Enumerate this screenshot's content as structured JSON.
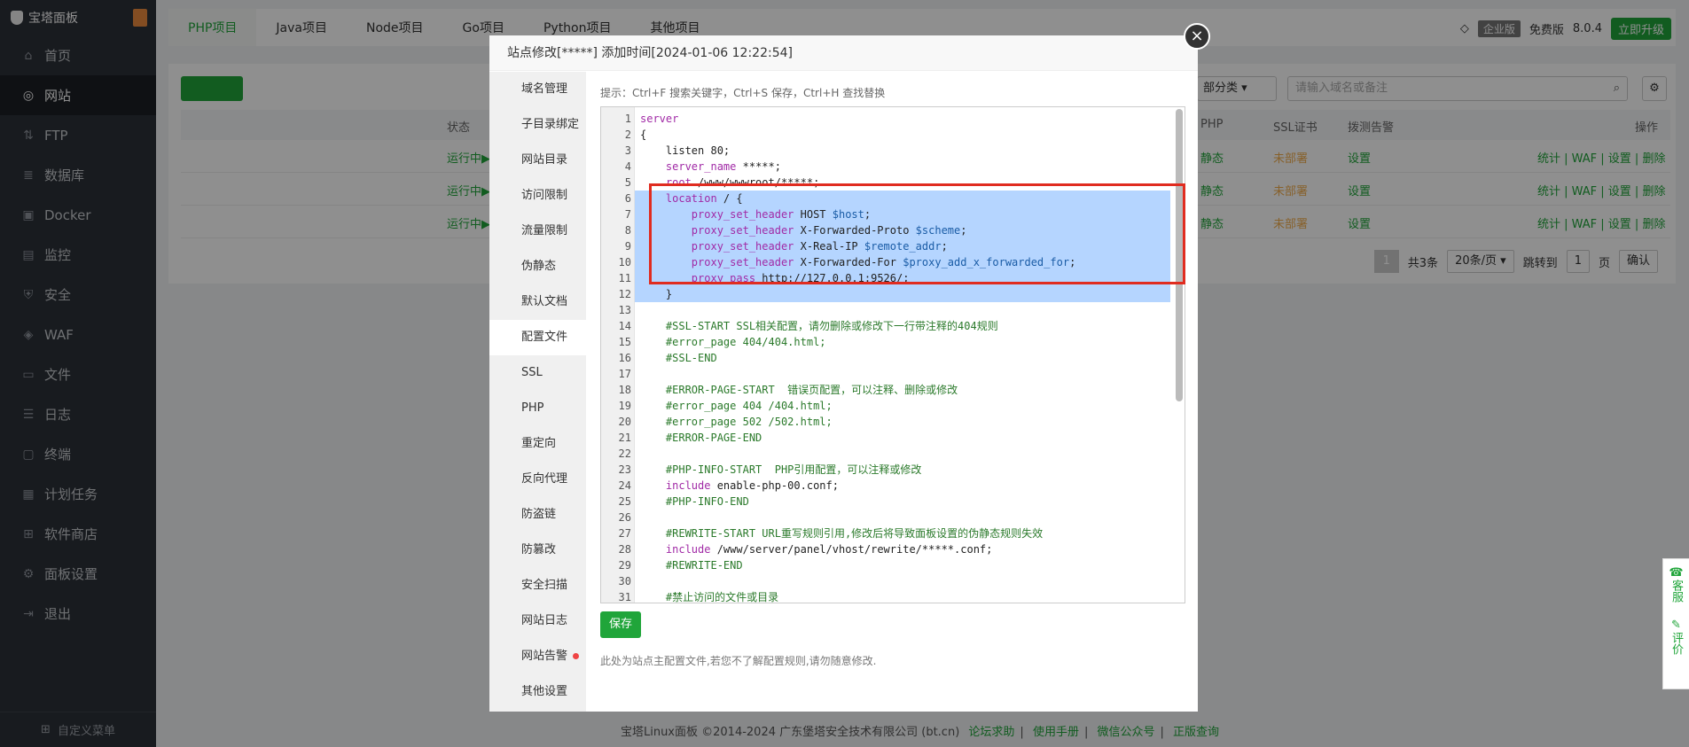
{
  "sidebar": {
    "brand": "宝塔面板",
    "items": [
      {
        "label": "首页",
        "icon": "home-icon"
      },
      {
        "label": "网站",
        "icon": "globe-icon",
        "active": true
      },
      {
        "label": "FTP",
        "icon": "ftp-icon"
      },
      {
        "label": "数据库",
        "icon": "database-icon"
      },
      {
        "label": "Docker",
        "icon": "docker-icon"
      },
      {
        "label": "监控",
        "icon": "monitor-icon"
      },
      {
        "label": "安全",
        "icon": "shield-icon"
      },
      {
        "label": "WAF",
        "icon": "waf-icon"
      },
      {
        "label": "文件",
        "icon": "folder-icon"
      },
      {
        "label": "日志",
        "icon": "log-icon"
      },
      {
        "label": "终端",
        "icon": "terminal-icon"
      },
      {
        "label": "计划任务",
        "icon": "calendar-icon"
      },
      {
        "label": "软件商店",
        "icon": "apps-icon"
      },
      {
        "label": "面板设置",
        "icon": "gear-icon"
      },
      {
        "label": "退出",
        "icon": "logout-icon"
      }
    ],
    "custom_menu": "自定义菜单"
  },
  "header": {
    "tabs": [
      "PHP项目",
      "Java项目",
      "Node项目",
      "Go项目",
      "Python项目",
      "其他项目"
    ],
    "edition": "企业版",
    "free_label": "免费版",
    "version": "8.0.4",
    "upgrade": "立即升级"
  },
  "table": {
    "search_placeholder": "请输入域名或备注",
    "category": "部分类",
    "columns": {
      "status": "状态",
      "php": "PHP",
      "ssl": "SSL证书",
      "alert": "拨测告警",
      "ops": "操作"
    },
    "rows": [
      {
        "status": "运行中▶",
        "php": "静态",
        "ssl": "未部署",
        "alert": "设置",
        "ops": "统计 | WAF | 设置 | 删除"
      },
      {
        "status": "运行中▶",
        "php": "静态",
        "ssl": "未部署",
        "alert": "设置",
        "ops": "统计 | WAF | 设置 | 删除"
      },
      {
        "status": "运行中▶",
        "php": "静态",
        "ssl": "未部署",
        "alert": "设置",
        "ops": "统计 | WAF | 设置 | 删除"
      }
    ],
    "pager": {
      "page": "1",
      "total": "共3条",
      "per_page": "20条/页",
      "jump_label": "跳转到",
      "jump_value": "1",
      "page_unit": "页",
      "confirm": "确认"
    }
  },
  "footer": {
    "copyright": "宝塔Linux面板 ©2014-2024 广东堡塔安全技术有限公司 (bt.cn)",
    "links": [
      "论坛求助",
      "使用手册",
      "微信公众号",
      "正版查询"
    ]
  },
  "service": {
    "chat": "客服",
    "rate": "评价"
  },
  "modal": {
    "title": "站点修改[*****]  添加时间[2024-01-06 12:22:54]",
    "menu": [
      "域名管理",
      "子目录绑定",
      "网站目录",
      "访问限制",
      "流量限制",
      "伪静态",
      "默认文档",
      "配置文件",
      "SSL",
      "PHP",
      "重定向",
      "反向代理",
      "防盗链",
      "防篡改",
      "安全扫描",
      "网站日志",
      "网站告警",
      "其他设置"
    ],
    "active_menu": "配置文件",
    "hint": "提示：Ctrl+F 搜索关键字，Ctrl+S 保存，Ctrl+H 查找替换",
    "save": "保存",
    "note": "此处为站点主配置文件,若您不了解配置规则,请勿随意修改.",
    "code_lines": [
      "server",
      "{",
      "    listen 80;",
      "    server_name *****;",
      "    root /www/wwwroot/*****;",
      "    location / {",
      "        proxy_set_header HOST $host;",
      "        proxy_set_header X-Forwarded-Proto $scheme;",
      "        proxy_set_header X-Real-IP $remote_addr;",
      "        proxy_set_header X-Forwarded-For $proxy_add_x_forwarded_for;",
      "        proxy_pass http://127.0.0.1:9526/;",
      "    }",
      "",
      "    #SSL-START SSL相关配置，请勿删除或修改下一行带注释的404规则",
      "    #error_page 404/404.html;",
      "    #SSL-END",
      "",
      "    #ERROR-PAGE-START  错误页配置，可以注释、删除或修改",
      "    #error_page 404 /404.html;",
      "    #error_page 502 /502.html;",
      "    #ERROR-PAGE-END",
      "",
      "    #PHP-INFO-START  PHP引用配置，可以注释或修改",
      "    include enable-php-00.conf;",
      "    #PHP-INFO-END",
      "",
      "    #REWRITE-START URL重写规则引用,修改后将导致面板设置的伪静态规则失效",
      "    include /www/server/panel/vhost/rewrite/*****.conf;",
      "    #REWRITE-END",
      "",
      "    #禁止访问的文件或目录"
    ],
    "selected_lines": [
      6,
      12
    ]
  }
}
